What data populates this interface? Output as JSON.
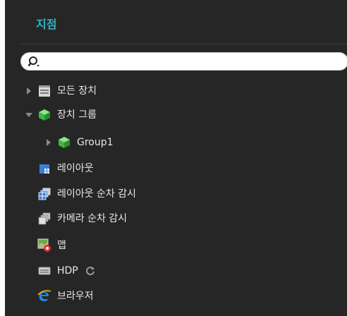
{
  "panel": {
    "title": "지점",
    "search": {
      "placeholder": "",
      "value": ""
    }
  },
  "tree": {
    "items": [
      {
        "label": "모든 장치",
        "icon": "device-list-icon",
        "expand": "collapsed"
      },
      {
        "label": "장치 그룹",
        "icon": "device-group-icon",
        "expand": "expanded"
      },
      {
        "label": "Group1",
        "icon": "group-cube-icon",
        "expand": "collapsed"
      },
      {
        "label": "레이아웃",
        "icon": "layout-icon",
        "expand": "none"
      },
      {
        "label": "레이아웃 순차 감시",
        "icon": "layout-sequence-icon",
        "expand": "none"
      },
      {
        "label": "카메라 순차 감시",
        "icon": "camera-sequence-icon",
        "expand": "none"
      },
      {
        "label": "맵",
        "icon": "map-icon",
        "expand": "none"
      },
      {
        "label": "HDP",
        "icon": "hdp-icon",
        "expand": "none",
        "status_icon": "refresh-icon"
      },
      {
        "label": "브라우저",
        "icon": "browser-icon",
        "expand": "none"
      }
    ]
  },
  "colors": {
    "panel_bg": "#262626",
    "title": "#2fb5c5",
    "text": "#e8e8e8",
    "group_green": "#4ec94e"
  }
}
